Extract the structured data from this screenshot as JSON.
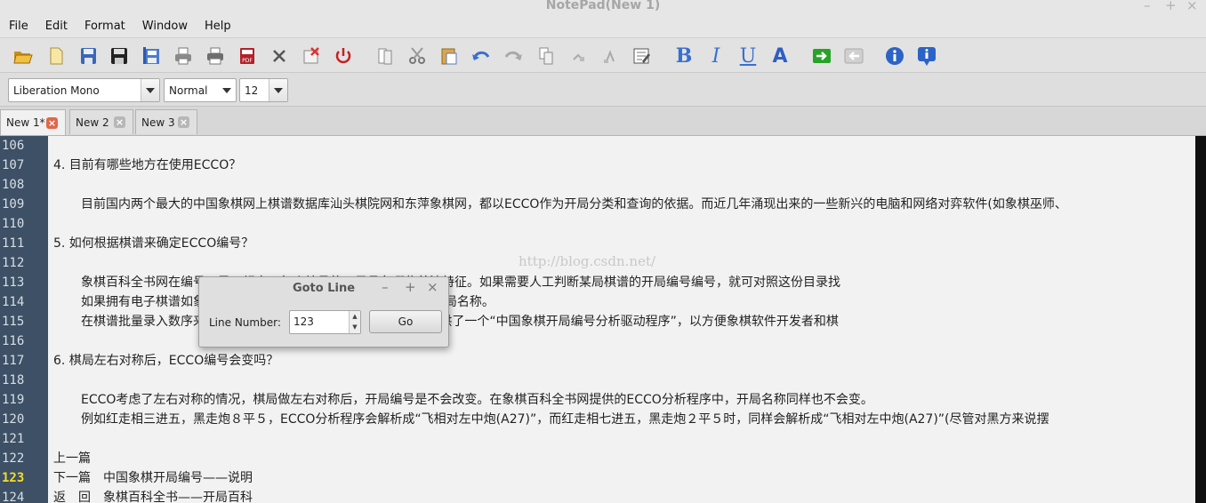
{
  "window": {
    "title": "NotePad(New 1)",
    "controls": [
      "–",
      "+",
      "×"
    ]
  },
  "menu": [
    "File",
    "Edit",
    "Format",
    "Window",
    "Help"
  ],
  "toolbar": {
    "icons": [
      "open-folder-icon",
      "new-file-icon",
      "save-icon",
      "save-as-icon",
      "save-all-icon",
      "print-icon",
      "print-preview-icon",
      "export-pdf-icon",
      "close-icon",
      "close-all-icon",
      "quit-icon",
      "copy-icon",
      "cut-icon",
      "paste-icon",
      "undo-icon",
      "redo-icon",
      "find-icon",
      "find-next-icon",
      "find-prev-icon",
      "goto-line-icon",
      "bold-icon",
      "italic-icon",
      "underline-icon",
      "font-color-icon",
      "indent-icon",
      "unindent-icon",
      "info-icon",
      "about-icon"
    ],
    "bold": "B",
    "italic": "I",
    "underline": "U",
    "font_color": "A",
    "accent": "#3a6fd0"
  },
  "fontbar": {
    "font_family": "Liberation Mono",
    "style": "Normal",
    "size": "12"
  },
  "tabs": [
    {
      "label": "New 1*",
      "active": true
    },
    {
      "label": "New 2",
      "active": false
    },
    {
      "label": "New 3",
      "active": false
    }
  ],
  "editor": {
    "current_line": "123",
    "lines": [
      {
        "n": "106",
        "text": "",
        "indent": false
      },
      {
        "n": "107",
        "text": "4. 目前有哪些地方在使用ECCO？",
        "indent": false
      },
      {
        "n": "108",
        "text": "",
        "indent": false
      },
      {
        "n": "109",
        "text": "目前国内两个最大的中国象棋网上棋谱数据库汕头棋院网和东萍象棋网，都以ECCO作为开局分类和查询的依据。而近几年涌现出来的一些新兴的电脑和网络对弈软件(如象棋巫师、",
        "indent": true
      },
      {
        "n": "110",
        "text": "",
        "indent": false
      },
      {
        "n": "111",
        "text": "5. 如何根据棋谱来确定ECCO编号？",
        "indent": false
      },
      {
        "n": "112",
        "text": "",
        "indent": false
      },
      {
        "n": "113",
        "text": "象棋百科全书网在编号目录，规定了每个编号的开局具备哪些着法特征。如果需要人工判断某局棋谱的开局编号编号，就可对照这份目录找",
        "indent": true
      },
      {
        "n": "114",
        "text": "如果拥有电子棋谱如象棋巫师)打开棋谱，自动获得ECCO编号和开局名称。",
        "indent": true
      },
      {
        "n": "115",
        "text": "在棋谱批量录入数序来确定棋谱的ECCO编号。象棋百科全书网提供了一个“中国象棋开局编号分析驱动程序”，以方便象棋软件开发者和棋",
        "indent": true
      },
      {
        "n": "116",
        "text": "",
        "indent": false
      },
      {
        "n": "117",
        "text": "6. 棋局左右对称后，ECCO编号会变吗？",
        "indent": false
      },
      {
        "n": "118",
        "text": "",
        "indent": false
      },
      {
        "n": "119",
        "text": "ECCO考虑了左右对称的情况，棋局做左右对称后，开局编号是不会改变。在象棋百科全书网提供的ECCO分析程序中，开局名称同样也不会变。",
        "indent": true
      },
      {
        "n": "120",
        "text": "例如红走相三进五，黑走炮８平５，ECCO分析程序会解析成“飞相对左中炮(A27)”，而红走相七进五，黑走炮２平５时，同样会解析成“飞相对左中炮(A27)”(尽管对黑方来说摆",
        "indent": true
      },
      {
        "n": "121",
        "text": "",
        "indent": false
      },
      {
        "n": "122",
        "text": "上一篇",
        "indent": false
      },
      {
        "n": "123",
        "text": "下一篇　中国象棋开局编号——说明",
        "indent": false
      },
      {
        "n": "124",
        "text": "返　回　象棋百科全书——开局百科",
        "indent": false
      }
    ],
    "watermark": "http://blog.csdn.net/"
  },
  "goto_dialog": {
    "title": "Goto Line",
    "controls": [
      "–",
      "+",
      "×"
    ],
    "label": "Line Number:",
    "value": "123",
    "go_label": "Go"
  }
}
